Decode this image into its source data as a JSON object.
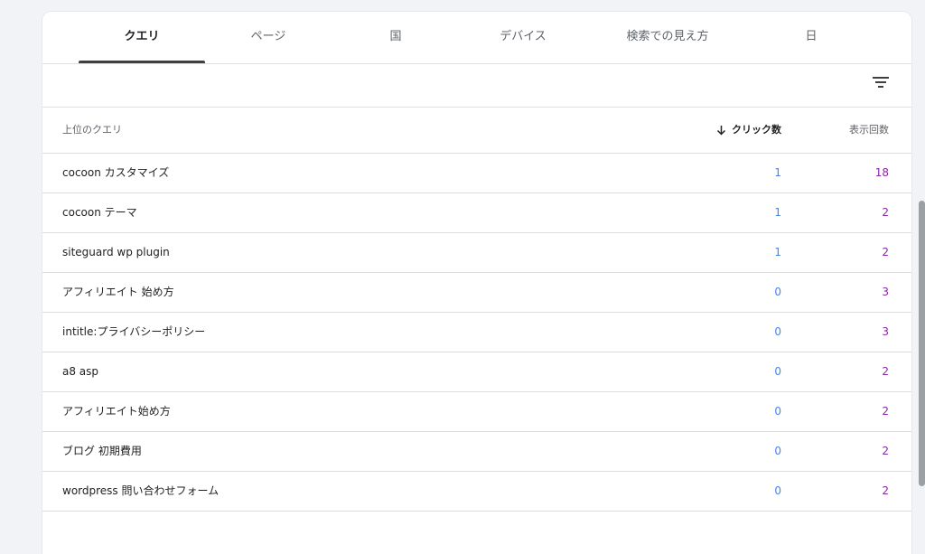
{
  "tabs": [
    {
      "label": "クエリ",
      "active": true
    },
    {
      "label": "ページ",
      "active": false
    },
    {
      "label": "国",
      "active": false
    },
    {
      "label": "デバイス",
      "active": false
    },
    {
      "label": "検索での見え方",
      "active": false
    },
    {
      "label": "日",
      "active": false
    }
  ],
  "filter": {
    "icon": "filter-icon"
  },
  "table": {
    "headers": {
      "query": "上位のクエリ",
      "clicks": "クリック数",
      "impressions": "表示回数"
    },
    "rows": [
      {
        "query": "cocoon カスタマイズ",
        "clicks": "1",
        "impressions": "18"
      },
      {
        "query": "cocoon テーマ",
        "clicks": "1",
        "impressions": "2"
      },
      {
        "query": "siteguard wp plugin",
        "clicks": "1",
        "impressions": "2"
      },
      {
        "query": "アフィリエイト 始め方",
        "clicks": "0",
        "impressions": "3"
      },
      {
        "query": "intitle:プライバシーポリシー",
        "clicks": "0",
        "impressions": "3"
      },
      {
        "query": "a8 asp",
        "clicks": "0",
        "impressions": "2"
      },
      {
        "query": "アフィリエイト始め方",
        "clicks": "0",
        "impressions": "2"
      },
      {
        "query": "ブログ 初期費用",
        "clicks": "0",
        "impressions": "2"
      },
      {
        "query": "wordpress 問い合わせフォーム",
        "clicks": "0",
        "impressions": "2"
      }
    ]
  },
  "colors": {
    "clicks": "#4285f4",
    "impressions": "#8e24aa",
    "active_indicator": "#3c4043"
  }
}
